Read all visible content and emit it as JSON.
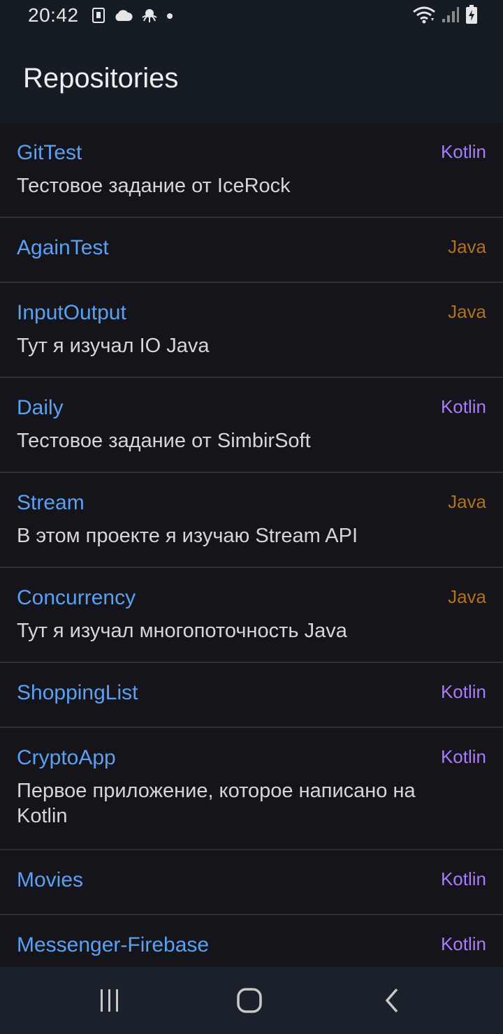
{
  "status_bar": {
    "time": "20:42",
    "left_icons": [
      "sim-card-icon",
      "cloud-icon",
      "octopus-icon",
      "dot-icon"
    ],
    "right_icons": [
      "wifi-icon",
      "signal-icon",
      "battery-icon"
    ]
  },
  "app_bar": {
    "title": "Repositories"
  },
  "colors": {
    "repo_name": "#5aa1f2",
    "kotlin": "#a97bff",
    "java": "#b07219"
  },
  "repositories": [
    {
      "name": "GitTest",
      "language": "Kotlin",
      "description": "Тестовое задание от IceRock"
    },
    {
      "name": "AgainTest",
      "language": "Java",
      "description": ""
    },
    {
      "name": "InputOutput",
      "language": "Java",
      "description": "Тут я изучал IO Java"
    },
    {
      "name": "Daily",
      "language": "Kotlin",
      "description": "Тестовое задание от SimbirSoft"
    },
    {
      "name": "Stream",
      "language": "Java",
      "description": "В этом проекте я изучаю Stream API"
    },
    {
      "name": "Concurrency",
      "language": "Java",
      "description": "Тут я изучал многопоточность Java"
    },
    {
      "name": "ShoppingList",
      "language": "Kotlin",
      "description": ""
    },
    {
      "name": "CryptoApp",
      "language": "Kotlin",
      "description": "Первое  приложение, которое написано на Kotlin"
    },
    {
      "name": "Movies",
      "language": "Kotlin",
      "description": ""
    },
    {
      "name": "Messenger-Firebase",
      "language": "Kotlin",
      "description": ""
    }
  ],
  "nav_bar": {
    "buttons": [
      "recent-apps-icon",
      "home-icon",
      "back-icon"
    ]
  }
}
